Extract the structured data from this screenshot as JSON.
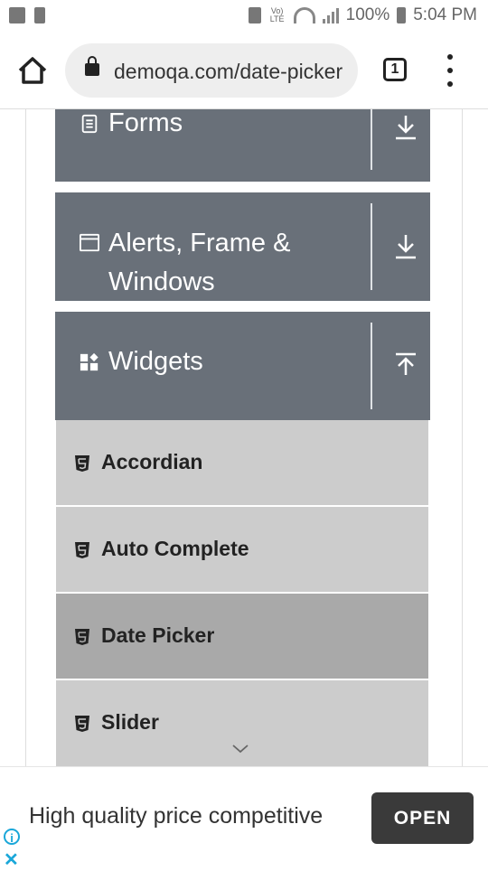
{
  "status_bar": {
    "network_label": "Vo) LTE",
    "battery": "100%",
    "time": "5:04 PM"
  },
  "browser": {
    "url": "demoqa.com/date-picker",
    "tab_count": "1",
    "icons": [
      "home-icon",
      "lock-icon",
      "tab-switcher-icon",
      "more-vert-icon"
    ]
  },
  "sidebar": {
    "groups": [
      {
        "label": "Forms",
        "icon": "document-icon",
        "expanded": false
      },
      {
        "label": "Alerts, Frame & Windows",
        "label_line1": "Alerts, Frame &",
        "label_line2": "Windows",
        "icon": "window-icon",
        "expanded": false
      },
      {
        "label": "Widgets",
        "icon": "widgets-icon",
        "expanded": true
      }
    ],
    "items": [
      {
        "label": "Accordian",
        "icon": "html5-icon",
        "active": false
      },
      {
        "label": "Auto Complete",
        "icon": "html5-icon",
        "active": false
      },
      {
        "label": "Date Picker",
        "icon": "html5-icon",
        "active": true
      },
      {
        "label": "Slider",
        "icon": "html5-icon",
        "active": false
      }
    ]
  },
  "ad": {
    "text": "High quality price competitive",
    "button": "OPEN"
  },
  "colors": {
    "group_bg": "#697079",
    "item_bg": "#cccccc",
    "item_active_bg": "#a9a9a9",
    "ad_button": "#3a3a3a",
    "ad_icon": "#1aa7d9"
  }
}
